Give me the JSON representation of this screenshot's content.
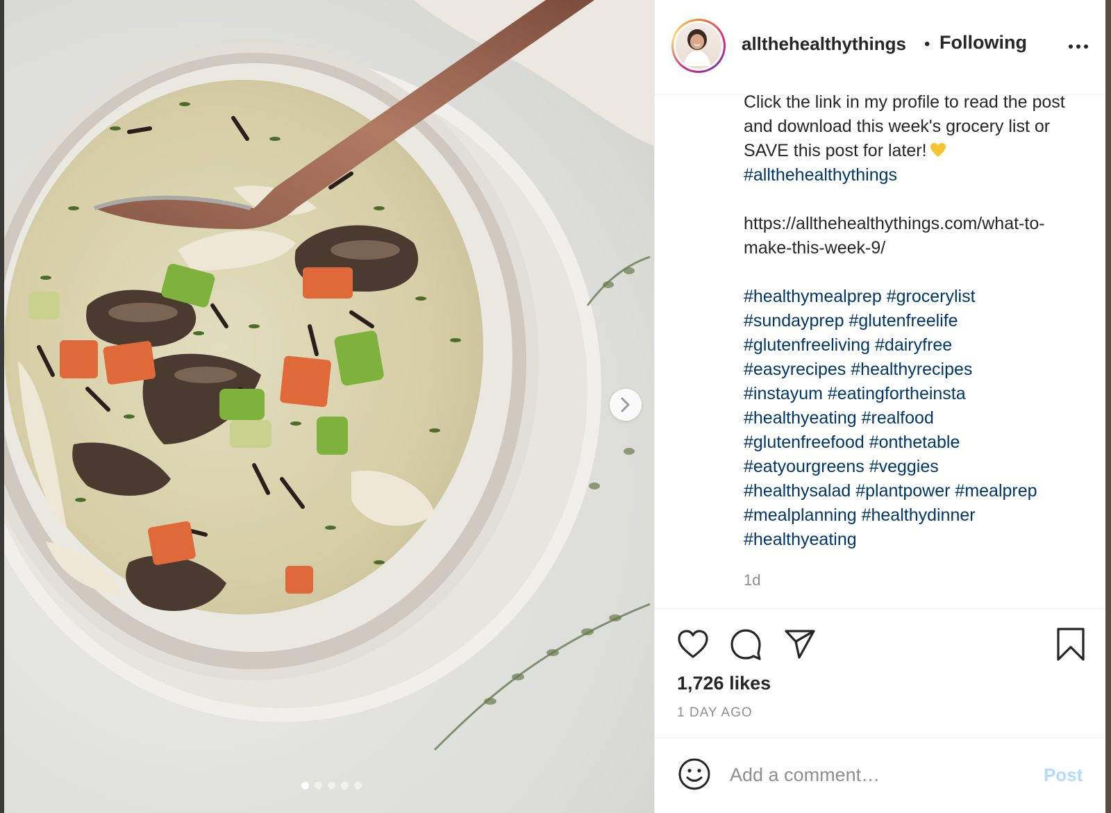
{
  "colors": {
    "link": "#00376b",
    "text": "#262626",
    "muted": "#8e8e8e",
    "post_disabled": "#b3dbff",
    "border": "#efefef"
  },
  "photo": {
    "carousel_total": 5,
    "carousel_active": 1,
    "next_icon": "chevron-right-icon"
  },
  "header": {
    "username": "allthehealthythings",
    "separator": "•",
    "follow_status": "Following",
    "more_icon": "more-options-icon"
  },
  "caption": {
    "line1": "Click the link in my profile to read the post and download this week's grocery list or SAVE this post for later!",
    "emoji": "yellow-heart-icon",
    "tag_main": "#allthehealthythings",
    "url": "https://allthehealthythings.com/what-to-make-this-week-9/",
    "hashtags": [
      "#healthymealprep",
      "#grocerylist",
      "#sundayprep",
      "#glutenfreelife",
      "#glutenfreeliving",
      "#dairyfree",
      "#easyrecipes",
      "#healthyrecipes",
      "#instayum",
      "#eatingfortheinsta",
      "#healthyeating",
      "#realfood",
      "#glutenfreefood",
      "#onthetable",
      "#eatyourgreens",
      "#veggies",
      "#healthysalad",
      "#plantpower",
      "#mealprep",
      "#mealplanning",
      "#healthydinner",
      "#healthyeating"
    ],
    "age": "1d"
  },
  "actions": {
    "like_icon": "heart-icon",
    "comment_icon": "comment-icon",
    "share_icon": "send-icon",
    "save_icon": "bookmark-icon",
    "likes": "1,726 likes",
    "posted": "1 DAY AGO"
  },
  "comment": {
    "emoji_icon": "smiley-icon",
    "placeholder": "Add a comment…",
    "post_label": "Post"
  }
}
